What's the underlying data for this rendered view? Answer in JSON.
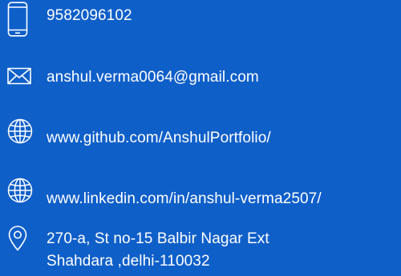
{
  "contact": {
    "phone": {
      "icon": "smartphone-icon",
      "value": "9582096102"
    },
    "email": {
      "icon": "envelope-icon",
      "value": "anshul.verma0064@gmail.com"
    },
    "github": {
      "icon": "globe-icon",
      "value": "www.github.com/AnshulPortfolio/"
    },
    "linkedin": {
      "icon": "globe-icon",
      "value": "www.linkedin.com/in/anshul-verma2507/"
    },
    "address": {
      "icon": "location-pin-icon",
      "line1": "270-a, St no-15 Balbir Nagar Ext",
      "line2": "Shahdara ,delhi-110032"
    }
  },
  "colors": {
    "background": "#0f5fc9",
    "text": "#ffffff"
  }
}
